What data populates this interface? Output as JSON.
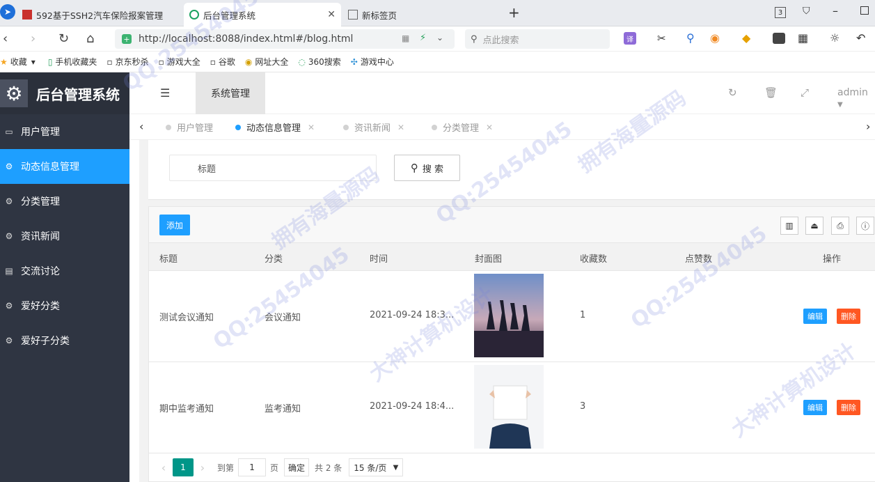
{
  "browser": {
    "tabs": [
      {
        "title": "592基于SSH2汽车保险报案管理"
      },
      {
        "title": "后台管理系统"
      },
      {
        "title": "新标签页"
      }
    ],
    "url": "http://localhost:8088/index.html#/blog.html",
    "search_placeholder": "点此搜索",
    "tab_count": "3",
    "bookmarks": [
      "收藏",
      "手机收藏夹",
      "京东秒杀",
      "游戏大全",
      "谷歌",
      "网址大全",
      "360搜索",
      "游戏中心"
    ]
  },
  "app": {
    "logo_text": "后台管理系统",
    "header": {
      "system_label": "系统管理",
      "user": "admin"
    },
    "sidebar": [
      {
        "label": "用户管理",
        "icon": "window-icon"
      },
      {
        "label": "动态信息管理",
        "icon": "gears-icon"
      },
      {
        "label": "分类管理",
        "icon": "gears-icon"
      },
      {
        "label": "资讯新闻",
        "icon": "gears-icon"
      },
      {
        "label": "交流讨论",
        "icon": "file-icon"
      },
      {
        "label": "爱好分类",
        "icon": "gears-icon"
      },
      {
        "label": "爱好子分类",
        "icon": "gears-icon"
      }
    ],
    "active_menu": 1,
    "page_tabs": [
      {
        "label": "用户管理"
      },
      {
        "label": "动态信息管理"
      },
      {
        "label": "资讯新闻"
      },
      {
        "label": "分类管理"
      }
    ],
    "search": {
      "placeholder": "标题",
      "button": "搜 索"
    },
    "toolbar": {
      "add_label": "添加"
    },
    "table": {
      "headers": [
        "标题",
        "分类",
        "时间",
        "封面图",
        "收藏数",
        "点赞数",
        "操作"
      ],
      "rows": [
        {
          "title": "测试会议通知",
          "category": "会议通知",
          "time": "2021-09-24 18:3...",
          "favorites": "1",
          "likes": "",
          "edit": "编辑",
          "delete": "删除"
        },
        {
          "title": "期中监考通知",
          "category": "监考通知",
          "time": "2021-09-24 18:4...",
          "favorites": "3",
          "likes": "",
          "edit": "编辑",
          "delete": "删除"
        }
      ]
    },
    "pager": {
      "current": "1",
      "goto_label": "到第",
      "goto_value": "1",
      "page_label": "页",
      "confirm": "确定",
      "total": "共 2 条",
      "per_page": "15 条/页"
    }
  },
  "watermark": {
    "qq": "QQ:25454045",
    "text1": "拥有海量源码",
    "text2": "大神计算机设计"
  },
  "colors": {
    "sidebar": "#2f3542",
    "accent": "#1e9fff",
    "danger": "#ff5722",
    "pager_active": "#009688"
  }
}
